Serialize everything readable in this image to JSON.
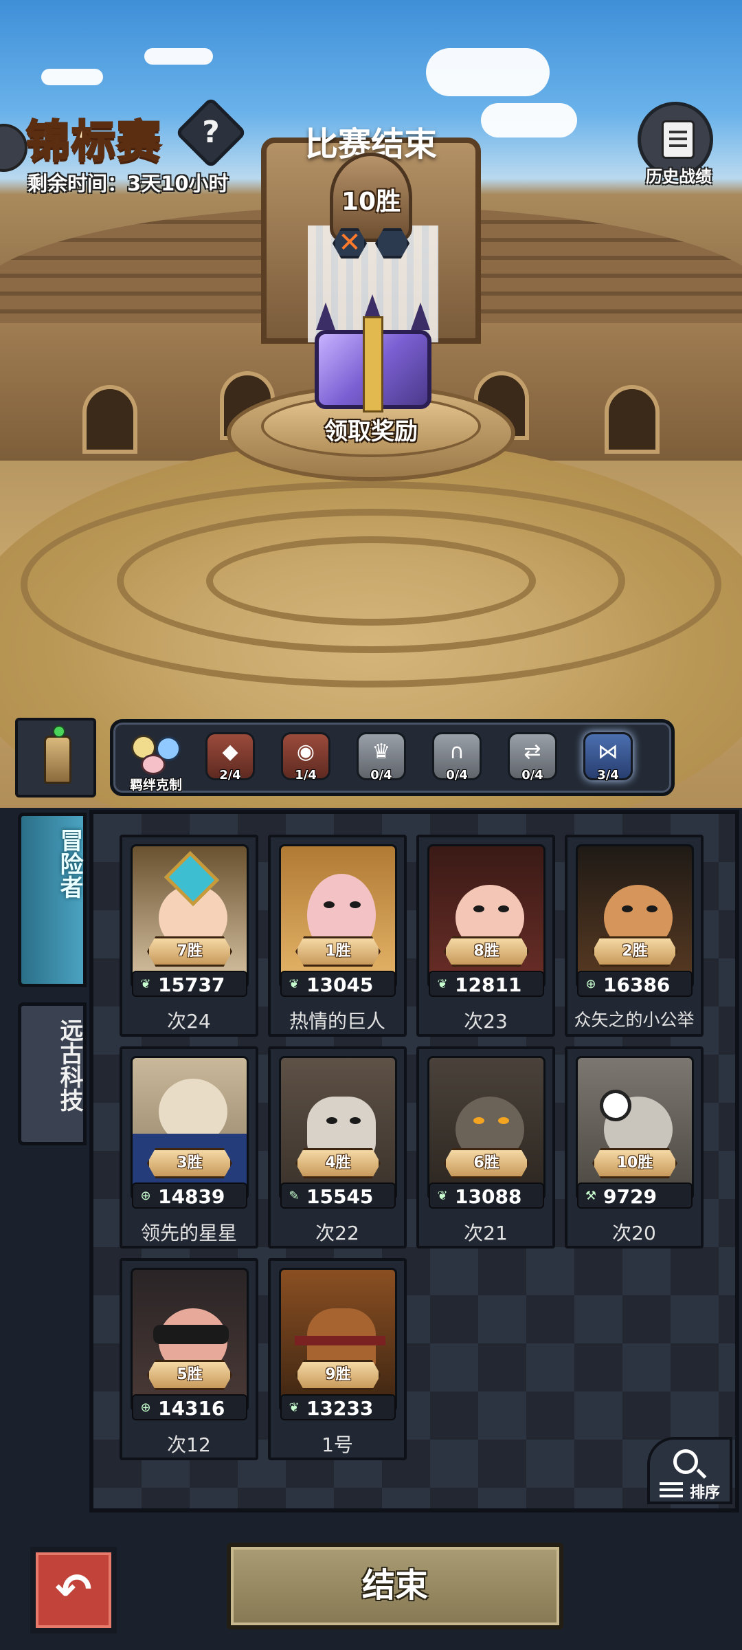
{
  "header": {
    "title": "锦标赛",
    "help_symbol": "?",
    "remaining_time": "剩余时间：3天10小时",
    "history_label": "历史战绩"
  },
  "match": {
    "status": "比赛结束",
    "wins": "10胜",
    "claim_label": "领取奖励"
  },
  "synergy": {
    "label": "羁绊克制",
    "items": [
      {
        "count": "2/4",
        "style": "red"
      },
      {
        "count": "1/4",
        "style": "red"
      },
      {
        "count": "0/4",
        "style": "grey"
      },
      {
        "count": "0/4",
        "style": "grey"
      },
      {
        "count": "0/4",
        "style": "grey"
      },
      {
        "count": "3/4",
        "style": "blue"
      }
    ]
  },
  "tabs": {
    "adventurers": "冒险者",
    "ancient_tech": "远古科技"
  },
  "heroes": [
    {
      "wins": "7胜",
      "power": "15737",
      "name": "次24",
      "icon": "leaf"
    },
    {
      "wins": "1胜",
      "power": "13045",
      "name": "热情的巨人",
      "icon": "leaf"
    },
    {
      "wins": "8胜",
      "power": "12811",
      "name": "次23",
      "icon": "leaf"
    },
    {
      "wins": "2胜",
      "power": "16386",
      "name": "众矢之的小公举",
      "icon": "target"
    },
    {
      "wins": "3胜",
      "power": "14839",
      "name": "领先的星星",
      "icon": "target"
    },
    {
      "wins": "4胜",
      "power": "15545",
      "name": "次22",
      "icon": "feather"
    },
    {
      "wins": "6胜",
      "power": "13088",
      "name": "次21",
      "icon": "leaf"
    },
    {
      "wins": "10胜",
      "power": "9729",
      "name": "次20",
      "icon": "wrench"
    },
    {
      "wins": "5胜",
      "power": "14316",
      "name": "次12",
      "icon": "target"
    },
    {
      "wins": "9胜",
      "power": "13233",
      "name": "1号",
      "icon": "leaf"
    }
  ],
  "sort_label": "排序",
  "end_label": "结束",
  "back_symbol": "↶"
}
